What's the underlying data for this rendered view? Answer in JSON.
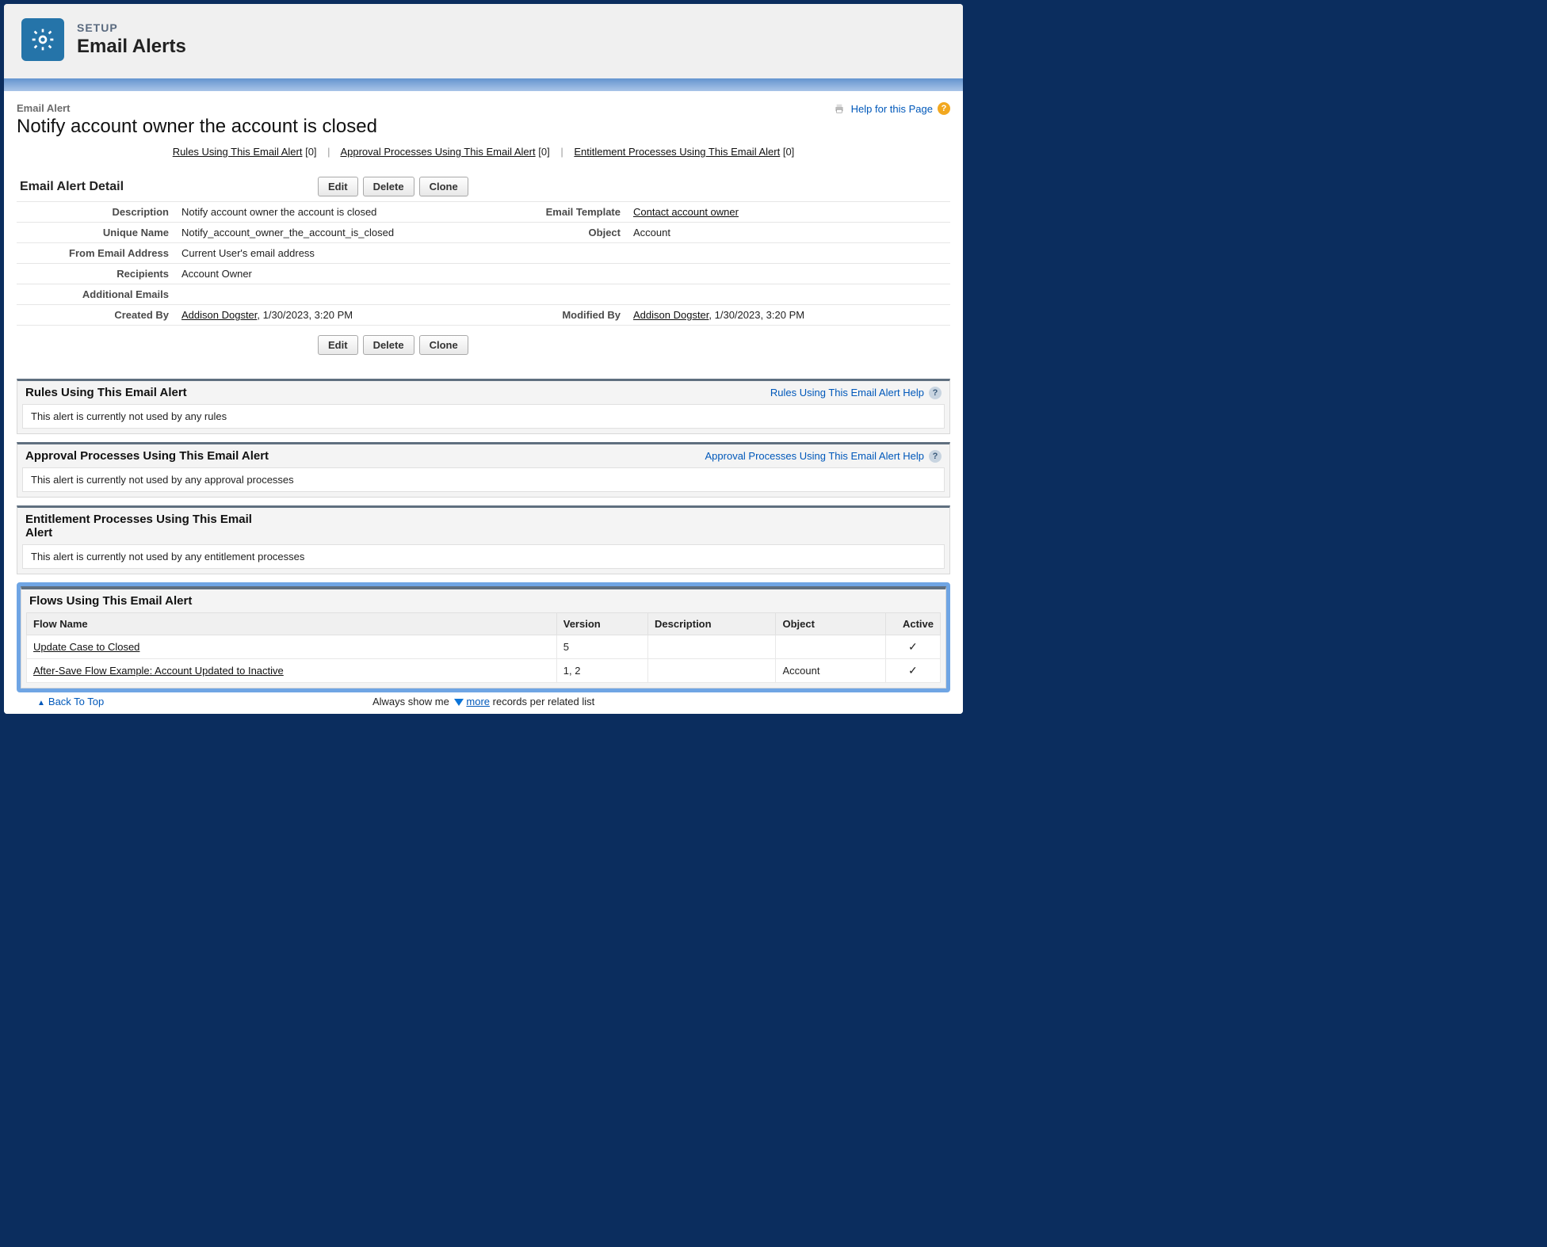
{
  "header": {
    "setup_label": "SETUP",
    "title": "Email Alerts"
  },
  "record": {
    "caption": "Email Alert",
    "title": "Notify account owner the account is closed"
  },
  "help": {
    "page_help_label": "Help for this Page"
  },
  "anchors": {
    "rules_label": "Rules Using This Email Alert",
    "rules_count": "[0]",
    "approval_label": "Approval Processes Using This Email Alert",
    "approval_count": "[0]",
    "entitlement_label": "Entitlement Processes Using This Email Alert",
    "entitlement_count": "[0]"
  },
  "detail_header": "Email Alert Detail",
  "buttons": {
    "edit": "Edit",
    "delete": "Delete",
    "clone": "Clone"
  },
  "detail": {
    "description_lbl": "Description",
    "description_val": "Notify account owner the account is closed",
    "email_template_lbl": "Email Template",
    "email_template_val": "Contact account owner",
    "unique_name_lbl": "Unique Name",
    "unique_name_val": "Notify_account_owner_the_account_is_closed",
    "object_lbl": "Object",
    "object_val": "Account",
    "from_email_lbl": "From Email Address",
    "from_email_val": "Current User's email address",
    "recipients_lbl": "Recipients",
    "recipients_val": "Account Owner",
    "additional_emails_lbl": "Additional Emails",
    "additional_emails_val": "",
    "created_by_lbl": "Created By",
    "created_by_user": "Addison Dogster",
    "created_by_date": ", 1/30/2023, 3:20 PM",
    "modified_by_lbl": "Modified By",
    "modified_by_user": "Addison Dogster",
    "modified_by_date": ", 1/30/2023, 3:20 PM"
  },
  "related": {
    "rules_title": "Rules Using This Email Alert",
    "rules_help": "Rules Using This Email Alert Help",
    "rules_msg": "This alert is currently not used by any rules",
    "approval_title": "Approval Processes Using This Email Alert",
    "approval_help": "Approval Processes Using This Email Alert Help",
    "approval_msg": "This alert is currently not used by any approval processes",
    "entitlement_title": "Entitlement Processes Using This Email Alert",
    "entitlement_msg": "This alert is currently not used by any entitlement processes"
  },
  "flows": {
    "title": "Flows Using This Email Alert",
    "columns": {
      "flow_name": "Flow Name",
      "version": "Version",
      "description": "Description",
      "object": "Object",
      "active": "Active"
    },
    "rows": [
      {
        "name": "Update Case to Closed",
        "version": "5",
        "description": "",
        "object": "",
        "active": "✓"
      },
      {
        "name": "After-Save Flow Example: Account Updated to Inactive",
        "version": "1, 2",
        "description": "",
        "object": "Account",
        "active": "✓"
      }
    ]
  },
  "footer": {
    "back_to_top": "Back To Top",
    "always_show_pre": "Always show me ",
    "more": "more",
    "always_show_post": " records per related list"
  }
}
